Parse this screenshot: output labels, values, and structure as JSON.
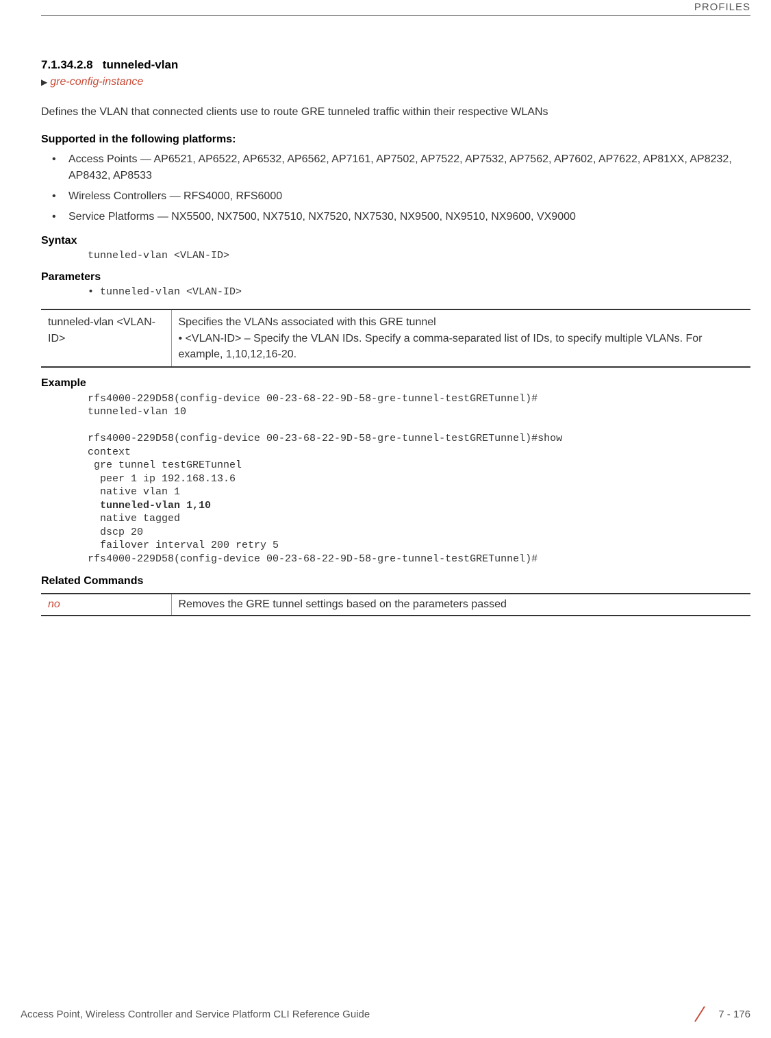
{
  "header": {
    "chapter": "PROFILES"
  },
  "section": {
    "number": "7.1.34.2.8",
    "title": "tunneled-vlan",
    "breadcrumb": "gre-config-instance"
  },
  "intro": "Defines the VLAN that connected clients use to route GRE tunneled traffic within their respective WLANs",
  "supported": {
    "heading": "Supported in the following platforms:",
    "items": [
      "Access Points — AP6521, AP6522, AP6532, AP6562, AP7161, AP7502, AP7522, AP7532, AP7562, AP7602, AP7622, AP81XX, AP8232, AP8432, AP8533",
      "Wireless Controllers — RFS4000, RFS6000",
      "Service Platforms — NX5500, NX7500, NX7510, NX7520, NX7530, NX9500, NX9510, NX9600, VX9000"
    ]
  },
  "syntax": {
    "heading": "Syntax",
    "code": "tunneled-vlan <VLAN-ID>"
  },
  "parameters": {
    "heading": "Parameters",
    "code": "tunneled-vlan <VLAN-ID>",
    "table": {
      "left": "tunneled-vlan <VLAN-ID>",
      "right_line1": "Specifies the VLANs associated with this GRE tunnel",
      "right_line2": "<VLAN-ID> – Specify the VLAN IDs. Specify a comma-separated list of IDs, to specify multiple VLANs. For example, 1,10,12,16-20."
    }
  },
  "example": {
    "heading": "Example",
    "line1": "rfs4000-229D58(config-device 00-23-68-22-9D-58-gre-tunnel-testGRETunnel)#",
    "line2": "tunneled-vlan 10",
    "line3": "",
    "line4": "rfs4000-229D58(config-device 00-23-68-22-9D-58-gre-tunnel-testGRETunnel)#show",
    "line5": "context",
    "line6": " gre tunnel testGRETunnel",
    "line7": "  peer 1 ip 192.168.13.6",
    "line8": "  native vlan 1",
    "line9": "  tunneled-vlan 1,10",
    "line10": "  native tagged",
    "line11": "  dscp 20",
    "line12": "  failover interval 200 retry 5",
    "line13": "rfs4000-229D58(config-device 00-23-68-22-9D-58-gre-tunnel-testGRETunnel)#"
  },
  "related": {
    "heading": "Related Commands",
    "table": {
      "left": "no",
      "right": "Removes the GRE tunnel settings based on the parameters passed"
    }
  },
  "footer": {
    "title": "Access Point, Wireless Controller and Service Platform CLI Reference Guide",
    "page": "7 - 176"
  }
}
